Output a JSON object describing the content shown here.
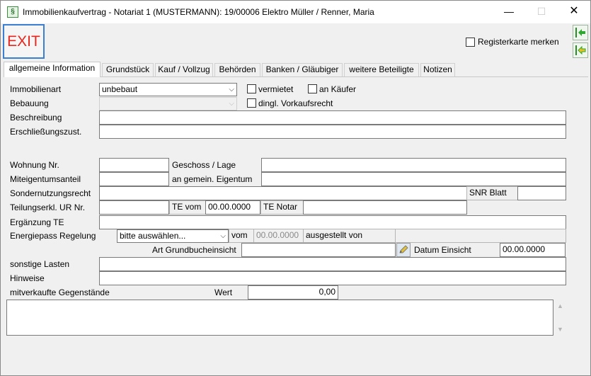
{
  "window": {
    "title": "Immobilienkaufvertrag - Notariat 1 (MUSTERMANN): 19/00006 Elektro Müller / Renner, Maria",
    "app_icon": "paragraph-icon",
    "minimize": "—",
    "maximize": "☐",
    "close": "✕"
  },
  "toolbar": {
    "exit_label": "EXIT",
    "register_label": "Registerkarte merken",
    "register_checked": false,
    "nav_icons": [
      "arrow-left-bar-icon",
      "arrow-left-bar-yellow-icon"
    ]
  },
  "tabs": [
    "allgemeine Information",
    "Grundstück",
    "Kauf / Vollzug",
    "Behörden",
    "Banken / Gläubiger",
    "weitere Beteiligte",
    "Notizen"
  ],
  "active_tab": "allgemeine Information",
  "form": {
    "immobilienart_label": "Immobilienart",
    "immobilienart_value": "unbebaut",
    "vermietet_label": "vermietet",
    "an_kaeufer_label": "an Käufer",
    "bebauung_label": "Bebauung",
    "bebauung_value": "",
    "vorkaufsrecht_label": "dingl. Vorkaufsrecht",
    "beschreibung_label": "Beschreibung",
    "beschreibung_value": "",
    "erschliessung_label": "Erschließungszust.",
    "erschliessung_value": "",
    "wohnung_label": "Wohnung Nr.",
    "wohnung_value": "",
    "geschoss_label": "Geschoss / Lage",
    "geschoss_value": "",
    "miteigentum_label": "Miteigentumsanteil",
    "miteigentum_value": "",
    "gemein_eigentum_label": "an gemein. Eigentum",
    "gemein_eigentum_value": "",
    "sondernutzung_label": "Sondernutzungsrecht",
    "sondernutzung_value": "",
    "snr_blatt_label": "SNR Blatt",
    "snr_blatt_value": "",
    "teilung_label": "Teilungserkl. UR Nr.",
    "teilung_value": "",
    "te_vom_label": "TE vom",
    "te_vom_value": "00.00.0000",
    "te_notar_label": "TE Notar",
    "te_notar_value": "",
    "ergaenzung_label": "Ergänzung TE",
    "ergaenzung_value": "",
    "energiepass_label": "Energiepass Regelung",
    "energiepass_value": "bitte auswählen...",
    "energie_vom_label": "vom",
    "energie_vom_value": "00.00.0000",
    "ausgestellt_label": "ausgestellt von",
    "ausgestellt_value": "",
    "grundbuch_label": "Art Grundbucheinsicht",
    "grundbuch_value": "",
    "datum_einsicht_label": "Datum Einsicht",
    "datum_einsicht_value": "00.00.0000",
    "sonstige_label": "sonstige Lasten",
    "sonstige_value": "",
    "hinweise_label": "Hinweise",
    "hinweise_value": "",
    "mitverkauft_label": "mitverkaufte Gegenstände",
    "wert_label": "Wert",
    "wert_value": "0,00",
    "mitverkauft_text": ""
  }
}
